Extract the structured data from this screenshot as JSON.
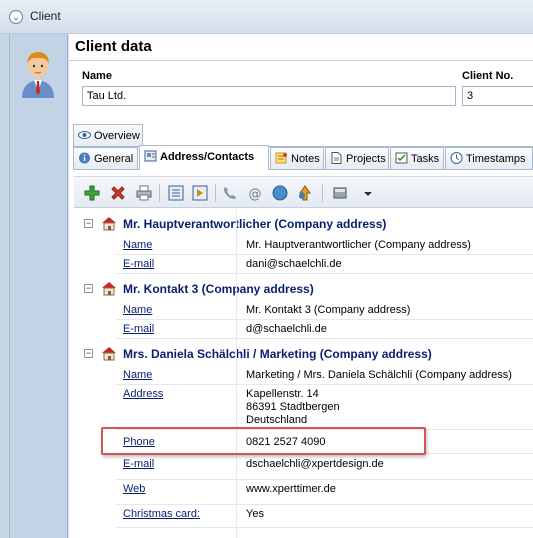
{
  "window": {
    "title": "Client"
  },
  "header": {
    "title": "Client data"
  },
  "fields": {
    "name_label": "Name",
    "name_value": "Tau Ltd.",
    "client_no_label": "Client No.",
    "client_no_value": "3"
  },
  "tabs": {
    "overview": "Overview",
    "general": "General",
    "address_contacts": "Address/Contacts",
    "notes": "Notes",
    "projects": "Projects",
    "tasks": "Tasks",
    "timestamps": "Timestamps"
  },
  "toolbar": {
    "icons": [
      "add-icon",
      "delete-icon",
      "print-icon",
      "move-left-icon",
      "move-right-icon",
      "phone-icon",
      "email-icon",
      "web-icon",
      "map-icon",
      "book-icon",
      "dropdown-icon"
    ]
  },
  "contacts": [
    {
      "title": "Mr. Hauptverantwortlicher (Company address)",
      "props": [
        {
          "label": "Name",
          "value": "Mr. Hauptverantwortlicher (Company address)"
        },
        {
          "label": "E-mail",
          "value": "dani@schaelchli.de"
        }
      ]
    },
    {
      "title": "Mr. Kontakt 3 (Company address)",
      "props": [
        {
          "label": "Name",
          "value": "Mr. Kontakt 3 (Company address)"
        },
        {
          "label": "E-mail",
          "value": "d@schaelchli.de"
        }
      ]
    },
    {
      "title": "Mrs. Daniela Schälchli / Marketing (Company address)",
      "props": [
        {
          "label": "Name",
          "value": "Marketing / Mrs. Daniela Schälchli (Company address)"
        },
        {
          "label": "Address",
          "value_lines": [
            "Kapellenstr. 14",
            "86391 Stadtbergen",
            "Deutschland"
          ]
        },
        {
          "label": "Phone",
          "value": "0821 2527 4090"
        },
        {
          "label": "E-mail",
          "value": "dschaelchli@xpertdesign.de"
        },
        {
          "label": "Web",
          "value": "www.xperttimer.de"
        },
        {
          "label": "Christmas card:",
          "value": "Yes"
        }
      ]
    }
  ],
  "colors": {
    "highlight": "#d9534f",
    "link": "#0a1e6e",
    "accent": "#2b5a93"
  }
}
